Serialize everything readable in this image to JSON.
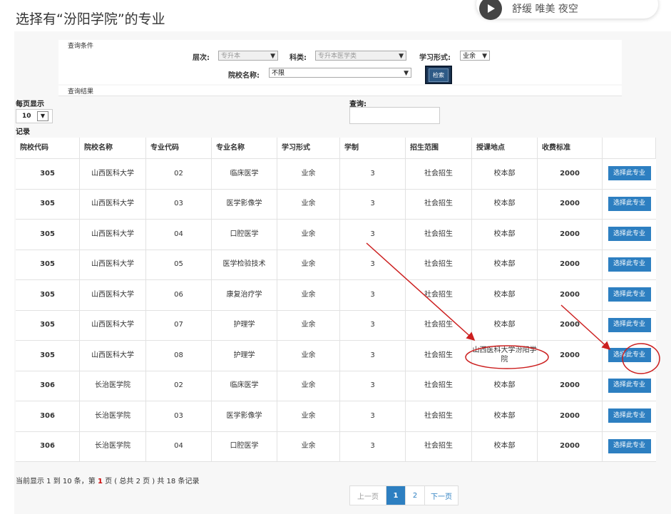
{
  "article": {
    "title": "选择有“汾阳学院”的专业",
    "music": {
      "text": "舒缓 唯美 夜空"
    }
  },
  "conditions": {
    "header": "查询条件",
    "level_label": "层次:",
    "level_value": "专升本",
    "category_label": "科类:",
    "category_value": "专升本医学类",
    "study_form_label": "学习形式:",
    "study_form_value": "业余",
    "school_label": "院校名称:",
    "school_value": "不限",
    "search_button": "检索"
  },
  "results": {
    "header": "查询结果",
    "per_page_label": "每页显示",
    "per_page_value": "10",
    "query_label": "查询:",
    "records_label": "记录",
    "columns": [
      "院校代码",
      "院校名称",
      "专业代码",
      "专业名称",
      "学习形式",
      "学制",
      "招生范围",
      "授课地点",
      "收费标准",
      ""
    ],
    "rows": [
      {
        "code": "305",
        "school": "山西医科大学",
        "major_code": "02",
        "major": "临床医学",
        "form": "业余",
        "years": "3",
        "scope": "社会招生",
        "location": "校本部",
        "fee": "2000",
        "action": "选择此专业"
      },
      {
        "code": "305",
        "school": "山西医科大学",
        "major_code": "03",
        "major": "医学影像学",
        "form": "业余",
        "years": "3",
        "scope": "社会招生",
        "location": "校本部",
        "fee": "2000",
        "action": "选择此专业"
      },
      {
        "code": "305",
        "school": "山西医科大学",
        "major_code": "04",
        "major": "口腔医学",
        "form": "业余",
        "years": "3",
        "scope": "社会招生",
        "location": "校本部",
        "fee": "2000",
        "action": "选择此专业"
      },
      {
        "code": "305",
        "school": "山西医科大学",
        "major_code": "05",
        "major": "医学检验技术",
        "form": "业余",
        "years": "3",
        "scope": "社会招生",
        "location": "校本部",
        "fee": "2000",
        "action": "选择此专业"
      },
      {
        "code": "305",
        "school": "山西医科大学",
        "major_code": "06",
        "major": "康复治疗学",
        "form": "业余",
        "years": "3",
        "scope": "社会招生",
        "location": "校本部",
        "fee": "2000",
        "action": "选择此专业"
      },
      {
        "code": "305",
        "school": "山西医科大学",
        "major_code": "07",
        "major": "护理学",
        "form": "业余",
        "years": "3",
        "scope": "社会招生",
        "location": "校本部",
        "fee": "2000",
        "action": "选择此专业"
      },
      {
        "code": "305",
        "school": "山西医科大学",
        "major_code": "08",
        "major": "护理学",
        "form": "业余",
        "years": "3",
        "scope": "社会招生",
        "location": "山西医科大学汾阳学院",
        "fee": "2000",
        "action": "选择此专业"
      },
      {
        "code": "306",
        "school": "长治医学院",
        "major_code": "02",
        "major": "临床医学",
        "form": "业余",
        "years": "3",
        "scope": "社会招生",
        "location": "校本部",
        "fee": "2000",
        "action": "选择此专业"
      },
      {
        "code": "306",
        "school": "长治医学院",
        "major_code": "03",
        "major": "医学影像学",
        "form": "业余",
        "years": "3",
        "scope": "社会招生",
        "location": "校本部",
        "fee": "2000",
        "action": "选择此专业"
      },
      {
        "code": "306",
        "school": "长治医学院",
        "major_code": "04",
        "major": "口腔医学",
        "form": "业余",
        "years": "3",
        "scope": "社会招生",
        "location": "校本部",
        "fee": "2000",
        "action": "选择此专业"
      }
    ],
    "footer": {
      "prefix": "当前显示 1 到 10 条，第 ",
      "page": "1",
      "suffix": " 页 ( 总共 2 页 ) 共 18 条记录"
    },
    "pager": {
      "prev": "上一页",
      "p1": "1",
      "p2": "2",
      "next": "下一页"
    }
  },
  "annotation_color": "#cc1f1f"
}
